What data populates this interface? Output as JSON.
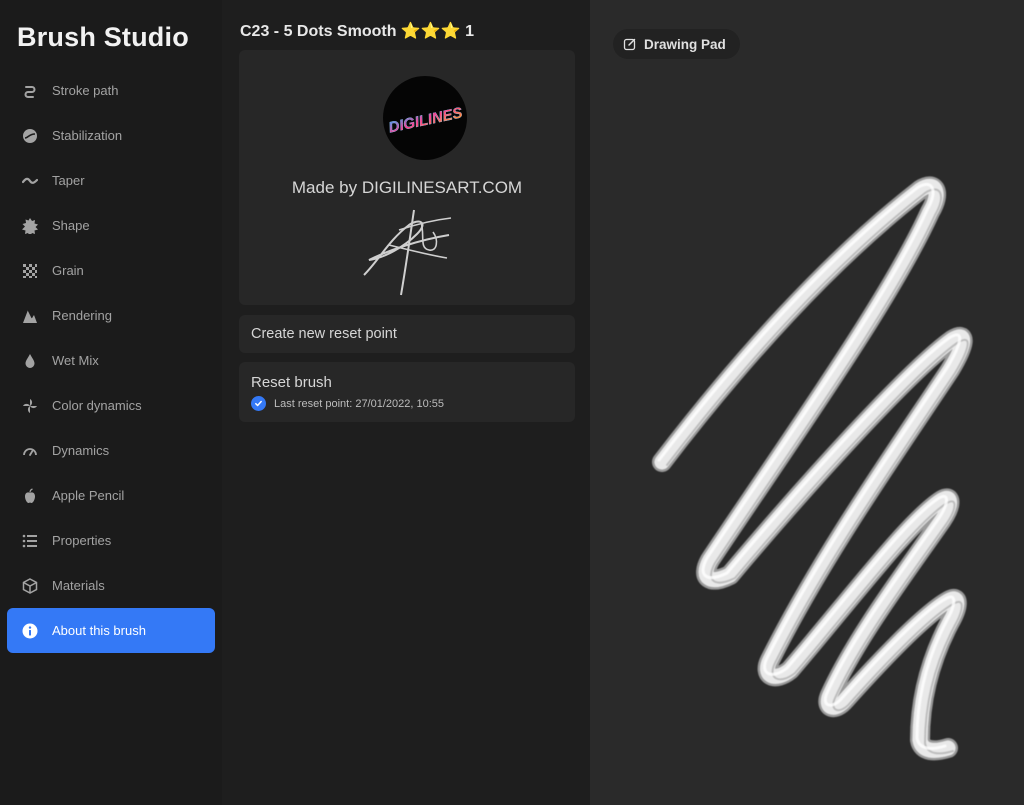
{
  "app": {
    "title": "Brush Studio"
  },
  "sidebar": {
    "items": [
      {
        "label": "Stroke path",
        "icon": "stroke-path-icon"
      },
      {
        "label": "Stabilization",
        "icon": "stabilization-icon"
      },
      {
        "label": "Taper",
        "icon": "taper-icon"
      },
      {
        "label": "Shape",
        "icon": "shape-icon"
      },
      {
        "label": "Grain",
        "icon": "grain-icon"
      },
      {
        "label": "Rendering",
        "icon": "rendering-icon"
      },
      {
        "label": "Wet Mix",
        "icon": "wet-mix-icon"
      },
      {
        "label": "Color dynamics",
        "icon": "color-dynamics-icon"
      },
      {
        "label": "Dynamics",
        "icon": "dynamics-icon"
      },
      {
        "label": "Apple Pencil",
        "icon": "apple-pencil-icon"
      },
      {
        "label": "Properties",
        "icon": "properties-icon"
      },
      {
        "label": "Materials",
        "icon": "materials-icon"
      },
      {
        "label": "About this brush",
        "icon": "info-icon",
        "active": true
      }
    ]
  },
  "about": {
    "brush_name": "C23 - 5 Dots Smooth ⭐⭐⭐ 1",
    "logo_text": "DIGILINES",
    "made_by": "Made by DIGILINESART.COM",
    "create_reset_point": "Create new reset point",
    "reset_brush": "Reset brush",
    "last_reset": "Last reset point: 27/01/2022, 10:55"
  },
  "drawing_pad": {
    "label": "Drawing Pad",
    "icon": "edit-icon"
  },
  "colors": {
    "accent": "#3479f6",
    "sidebar_bg": "#1b1b1b",
    "pad_bg": "#2a2a2a"
  }
}
